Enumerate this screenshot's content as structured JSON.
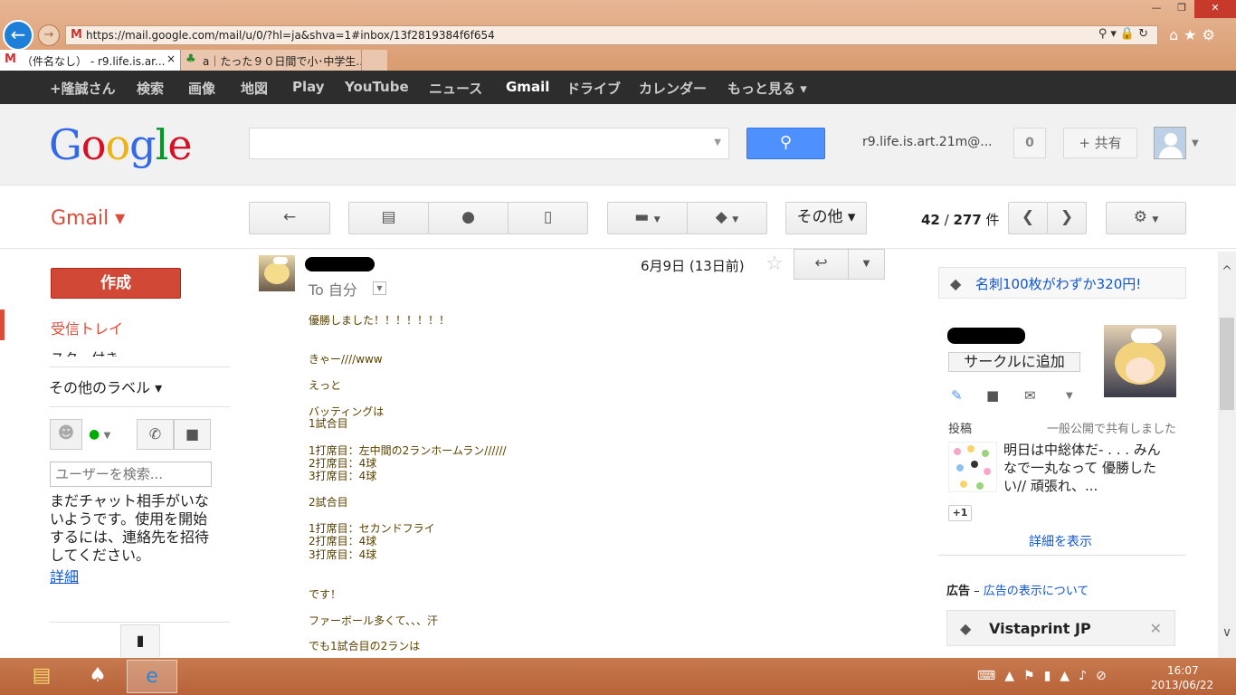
{
  "browser": {
    "url": "https://mail.google.com/mail/u/0/?hl=ja&shva=1#inbox/13f2819384f6f654",
    "tabs": [
      {
        "label": "（件名なし） - r9.life.is.ar...",
        "active": true
      },
      {
        "label": "a｜たった９０日間で小･中学生...",
        "active": false
      }
    ]
  },
  "gbar": {
    "items": [
      "+隆誠さん",
      "検索",
      "画像",
      "地図",
      "Play",
      "YouTube",
      "ニュース",
      "Gmail",
      "ドライブ",
      "カレンダー",
      "もっと見る ▾"
    ],
    "selected": "Gmail"
  },
  "header": {
    "logo": "Google",
    "account_email": "r9.life.is.art.21m@...",
    "notifications": "0",
    "share_label": "共有"
  },
  "gmail": {
    "label": "Gmail ▾",
    "toolbar": {
      "more_label": "その他 ▾",
      "count_current": "42",
      "count_sep": " / ",
      "count_total": "277",
      "count_unit": " 件"
    }
  },
  "nav": {
    "compose": "作成",
    "inbox": "受信トレイ",
    "starred": "スター付き",
    "more_labels": "その他のラベル  ▾"
  },
  "chat": {
    "search_placeholder": "ユーザーを検索...",
    "message": "まだチャット相手がいないようです。使用を開始するには、連絡先を招待してください。",
    "more_link": "詳細"
  },
  "message": {
    "date": "6月9日 (13日前)",
    "to": "To 自分",
    "body": [
      "優勝しました！！！！！！！",
      "",
      "きゃー////www",
      "",
      "えっと",
      "",
      "バッティングは",
      "1試合目",
      "",
      "1打席目：左中間の2ランホームラン//////",
      "2打席目：4球",
      "3打席目：4球",
      "",
      "2試合目",
      "",
      "1打席目：セカンドフライ",
      "2打席目：4球",
      "3打席目：4球",
      "",
      "",
      "です！",
      "",
      "ファーボール多くて、、、汗",
      "",
      "でも1試合目の2ランは"
    ]
  },
  "sidebar": {
    "top_ad": "名刺100枚がわずか320円!",
    "add_circle": "サークルに追加",
    "post_label": "投稿",
    "post_share": "一般公開で共有しました",
    "post_text": "明日は中総体だ- . . . みんなで一丸なって 優勝したい// 頑張れ、...",
    "plus_one": "+1",
    "show_detail": "詳細を表示",
    "ad_label": "広告",
    "ad_dash": " – ",
    "ad_about": "広告の表示について",
    "ad_name": "Vistaprint JP"
  },
  "taskbar": {
    "time": "16:07",
    "date": "2013/06/22"
  },
  "colors": {
    "gmail_red": "#dd4b39",
    "compose_red": "#d14836",
    "search_blue": "#4d90fe",
    "link_blue": "#1155cc",
    "gbar_dark": "#2d2d2d",
    "body_brown": "#5a4100"
  }
}
